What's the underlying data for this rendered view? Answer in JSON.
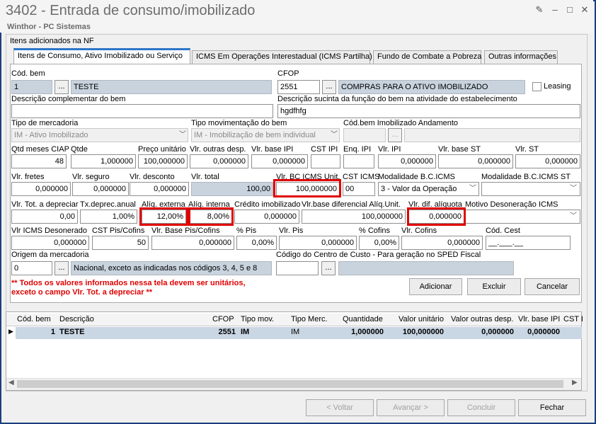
{
  "window": {
    "title": "3402 - Entrada de consumo/imobilizado",
    "subtitle": "Winthor - PC Sistemas"
  },
  "group_label": "Itens adicionados na NF",
  "tabs": [
    "Itens de Consumo, Ativo Imobilizado ou Serviço",
    "ICMS Em Operações Interestadual (ICMS Partilha)",
    "Fundo de Combate a Pobreza",
    "Outras informações"
  ],
  "fields": {
    "cod_bem": {
      "label": "Cód. bem",
      "code": "1",
      "desc": "TESTE"
    },
    "cfop": {
      "label": "CFOP",
      "code": "2551",
      "desc": "COMPRAS PARA O ATIVO IMOBILIZADO"
    },
    "leasing": "Leasing",
    "desc_compl": {
      "label": "Descrição complementar do bem",
      "value": ""
    },
    "desc_func": {
      "label": "Descrição sucinta da função do bem na atividade do estabelecimento",
      "value": "hgdfhfg"
    },
    "tipo_merc": {
      "label": "Tipo de mercadoria",
      "value": "IM - Ativo Imobilizado"
    },
    "tipo_mov": {
      "label": "Tipo movimentação do bem",
      "value": "IM - Imobilização de bem individual"
    },
    "cod_bem_imob": {
      "label": "Cód.bem Imobilizado Andamento"
    },
    "row3": [
      {
        "label": "Qtd meses CIAP",
        "value": "48"
      },
      {
        "label": "Qtde",
        "value": "1,000000"
      },
      {
        "label": "Preço unitário",
        "value": "100,000000"
      },
      {
        "label": "Vlr. outras desp.",
        "value": "0,000000"
      },
      {
        "label": "Vlr. base IPI",
        "value": "0,000000"
      },
      {
        "label": "CST IPI",
        "value": ""
      },
      {
        "label": "Enq. IPI",
        "value": ""
      },
      {
        "label": "Vlr. IPI",
        "value": "0,000000"
      },
      {
        "label": "Vlr. base ST",
        "value": "0,000000"
      },
      {
        "label": "Vlr. ST",
        "value": "0,000000"
      }
    ],
    "row4": [
      {
        "label": "Vlr. fretes",
        "value": "0,000000"
      },
      {
        "label": "Vlr. seguro",
        "value": "0,000000"
      },
      {
        "label": "Vlr. desconto",
        "value": "0,000000"
      },
      {
        "label": "Vlr. total",
        "value": "100,00"
      },
      {
        "label": "Vlr. BC ICMS Unit.",
        "value": "100,000000"
      },
      {
        "label": "CST ICMS",
        "value": "00"
      },
      {
        "label": "Modalidade B.C.ICMS",
        "value": "3 - Valor da Operação"
      },
      {
        "label": "Modalidade B.C.ICMS ST",
        "value": ""
      }
    ],
    "row5": [
      {
        "label": "Vlr. Tot. a depreciar",
        "value": "0,00"
      },
      {
        "label": "Tx.deprec.anual",
        "value": "1,00%"
      },
      {
        "label": "Alíq. externa",
        "value": "12,00%"
      },
      {
        "label": "Alíq. interna",
        "value": "8,00%"
      },
      {
        "label": "Crédito imobilizado",
        "value": "0,000000"
      },
      {
        "label": "Vlr.base diferencial Alíq.Unit.",
        "value": "100,000000"
      },
      {
        "label": "Vlr. dif. alíquota",
        "value": "0,000000"
      },
      {
        "label": "Motivo Desoneração ICMS",
        "value": ""
      }
    ],
    "row6": [
      {
        "label": "Vlr ICMS Desonerado",
        "value": "0,000000"
      },
      {
        "label": "CST Pis/Cofins",
        "value": "50"
      },
      {
        "label": "Vlr. Base Pis/Cofins",
        "value": "0,000000"
      },
      {
        "label": "% Pis",
        "value": "0,00%"
      },
      {
        "label": "Vlr. Pis",
        "value": "0,000000"
      },
      {
        "label": "% Cofins",
        "value": "0,00%"
      },
      {
        "label": "Vlr. Cofins",
        "value": "0,000000"
      },
      {
        "label": "Cód. Cest",
        "value": "__.___.__"
      }
    ],
    "origem": {
      "label": "Origem da mercadoria",
      "code": "0",
      "desc": "Nacional, exceto as indicadas nos códigos 3, 4, 5 e 8"
    },
    "centro_custo": {
      "label": "Código do Centro de Custo - Para geração no SPED Fiscal",
      "value": ""
    }
  },
  "warning": [
    "** Todos os valores informados nessa tela devem ser unitários,",
    "exceto o campo Vlr. Tot. a depreciar **"
  ],
  "buttons": {
    "adicionar": "Adicionar",
    "excluir": "Excluir",
    "cancelar": "Cancelar",
    "voltar": "< Voltar",
    "avancar": "Avançar >",
    "concluir": "Concluir",
    "fechar": "Fechar",
    "ellipsis": "..."
  },
  "grid": {
    "headers": [
      "Cód. bem",
      "Descrição",
      "CFOP",
      "Tipo mov.",
      "Tipo Merc.",
      "Quantidade",
      "Valor unitário",
      "Valor outras desp.",
      "Vlr. base IPI",
      "CST I"
    ],
    "row": [
      "1",
      "TESTE",
      "2551",
      "IM",
      "IM",
      "1,000000",
      "100,000000",
      "0,000000",
      "0,000000"
    ]
  }
}
